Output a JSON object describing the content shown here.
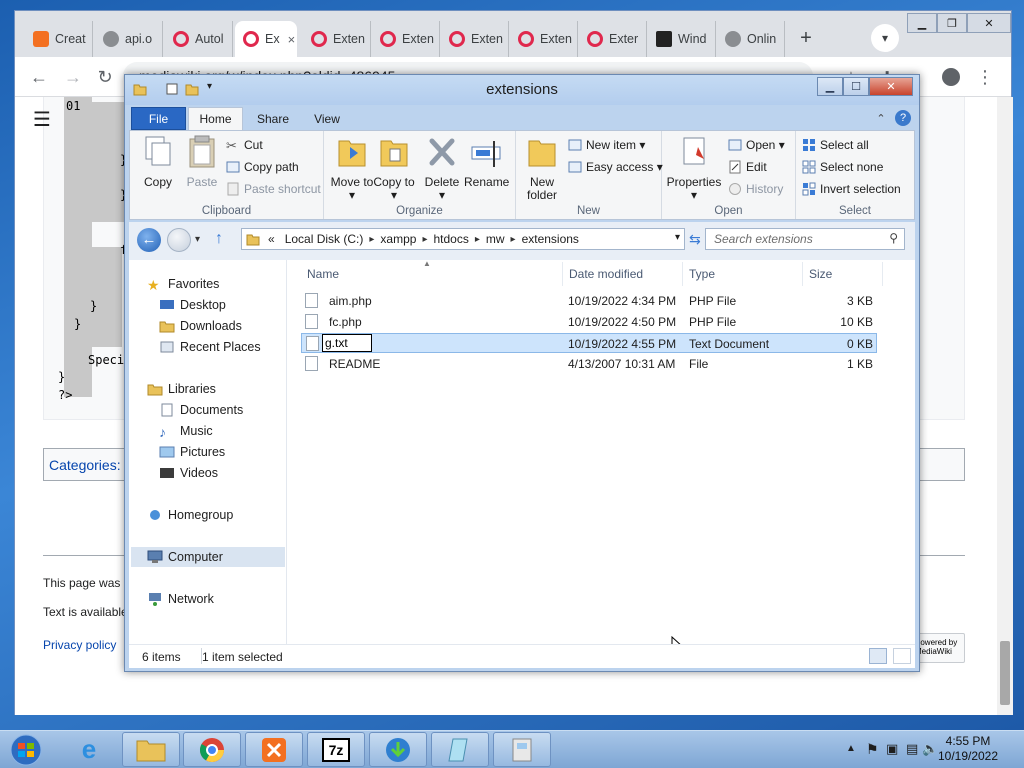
{
  "browser": {
    "tabs": [
      {
        "label": "Creat",
        "icon": "xampp-icon"
      },
      {
        "label": "api.o",
        "icon": "globe-icon"
      },
      {
        "label": "Autol",
        "icon": "opera-icon"
      },
      {
        "label": "Ex",
        "icon": "opera-icon",
        "active": true
      },
      {
        "label": "Exten",
        "icon": "opera-icon"
      },
      {
        "label": "Exten",
        "icon": "opera-icon"
      },
      {
        "label": "Exten",
        "icon": "opera-icon"
      },
      {
        "label": "Exten",
        "icon": "opera-icon"
      },
      {
        "label": "Exter",
        "icon": "opera-icon"
      },
      {
        "label": "Wind",
        "icon": "wiki-icon"
      },
      {
        "label": "Onlin",
        "icon": "globe-icon"
      }
    ],
    "tab_close": "×",
    "new_tab": "+",
    "url": "mediawiki.org/w/index.php?oldid=486945"
  },
  "wiki": {
    "code_lines": [
      "01",
      "}",
      "}",
      "f",
      "}",
      "}",
      "Speci",
      "}",
      "?>"
    ],
    "categories": "Categories:",
    "footer": {
      "modified": "This page was",
      "available": "Text is available",
      "privacy": "Privacy policy",
      "powered": "Powered by MediaWiki"
    }
  },
  "explorer": {
    "title": "extensions",
    "ribbon_tabs": {
      "file": "File",
      "home": "Home",
      "share": "Share",
      "view": "View"
    },
    "ribbon": {
      "clipboard": {
        "label": "Clipboard",
        "copy": "Copy",
        "paste": "Paste",
        "cut": "Cut",
        "copy_path": "Copy path",
        "paste_shortcut": "Paste shortcut"
      },
      "organize": {
        "label": "Organize",
        "move_to": "Move to ▾",
        "copy_to": "Copy to ▾",
        "delete": "Delete ▾",
        "rename": "Rename"
      },
      "new": {
        "label": "New",
        "new_folder": "New folder",
        "new_item": "New item ▾",
        "easy_access": "Easy access ▾"
      },
      "open": {
        "label": "Open",
        "properties": "Properties ▾",
        "open": "Open ▾",
        "edit": "Edit",
        "history": "History"
      },
      "select": {
        "label": "Select",
        "select_all": "Select all",
        "select_none": "Select none",
        "invert_selection": "Invert selection"
      }
    },
    "address": {
      "prefix": "«",
      "crumbs": [
        "Local Disk (C:)",
        "xampp",
        "htdocs",
        "mw",
        "extensions"
      ],
      "search_placeholder": "Search extensions"
    },
    "nav": {
      "favorites": "Favorites",
      "desktop": "Desktop",
      "downloads": "Downloads",
      "recent_places": "Recent Places",
      "libraries": "Libraries",
      "documents": "Documents",
      "music": "Music",
      "pictures": "Pictures",
      "videos": "Videos",
      "homegroup": "Homegroup",
      "computer": "Computer",
      "network": "Network"
    },
    "columns": {
      "name": "Name",
      "date": "Date modified",
      "type": "Type",
      "size": "Size"
    },
    "files": [
      {
        "name": "aim.php",
        "date": "10/19/2022 4:34 PM",
        "type": "PHP File",
        "size": "3 KB"
      },
      {
        "name": "fc.php",
        "date": "10/19/2022 4:50 PM",
        "type": "PHP File",
        "size": "10 KB"
      },
      {
        "name": "g.txt",
        "date": "10/19/2022 4:55 PM",
        "type": "Text Document",
        "size": "0 KB",
        "selected": true,
        "renaming": true
      },
      {
        "name": "README",
        "date": "4/13/2007 10:31 AM",
        "type": "File",
        "size": "1 KB"
      }
    ],
    "status": {
      "items": "6 items",
      "selected": "1 item selected"
    }
  },
  "taskbar": {
    "time": "4:55 PM",
    "date": "10/19/2022",
    "apps": [
      "internet-explorer-icon",
      "file-explorer-icon",
      "chrome-icon",
      "xampp-icon",
      "7zip-icon",
      "download-manager-icon",
      "notepad-icon",
      "paint-icon"
    ],
    "seven_zip_label": "7z"
  },
  "colors": {
    "ribbon_file_tab": "#2a68c4",
    "selection": "#cde4fc",
    "chrome_tabstrip": "#dee1e6",
    "taskbar": "#97b9e0"
  }
}
